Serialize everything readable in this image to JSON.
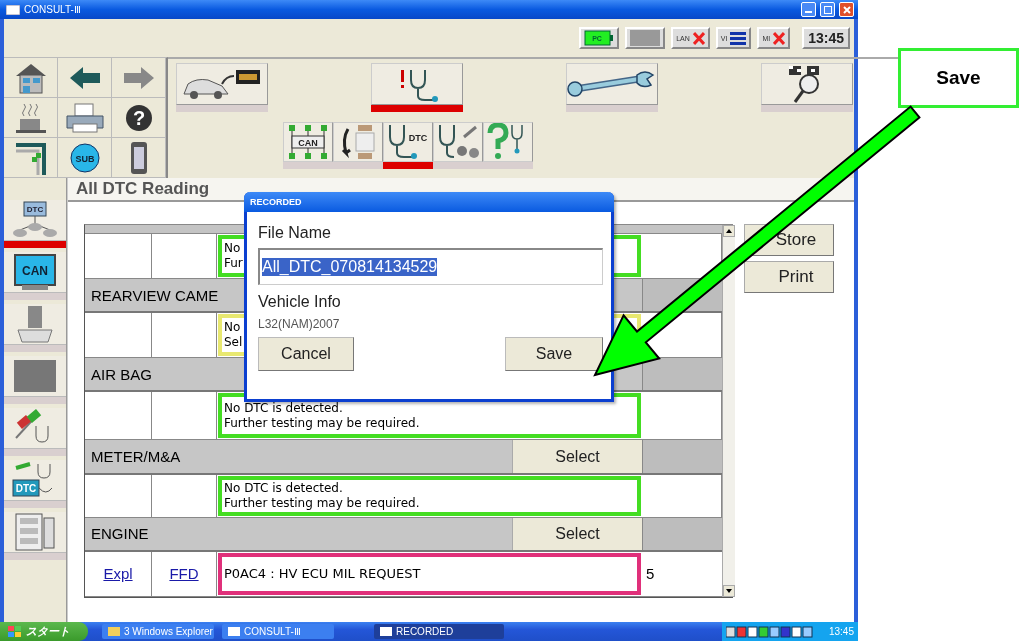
{
  "window": {
    "title": "CONSULT-Ⅲ"
  },
  "indicators": [
    {
      "kind": "battery",
      "label": "PC"
    },
    {
      "kind": "blank"
    },
    {
      "kind": "error",
      "label": "LAN"
    },
    {
      "kind": "bars",
      "label": "VI"
    },
    {
      "kind": "error",
      "label": "MI"
    }
  ],
  "clock": "13:45",
  "nav_labels": {
    "help": "?",
    "sub": "SUB"
  },
  "main_buttons": [
    {
      "selected": false
    },
    {
      "selected": true
    },
    {
      "selected": false
    },
    {
      "selected": false
    }
  ],
  "sub_buttons": [
    {
      "label": "CAN",
      "selected": false
    },
    {
      "selected": false
    },
    {
      "label": "DTC",
      "selected": true
    },
    {
      "selected": false
    },
    {
      "selected": false
    }
  ],
  "sidebar": [
    {
      "label": "DTC",
      "selected": true
    },
    {
      "label": "CAN",
      "selected": false
    },
    {
      "selected": false
    },
    {
      "selected": false
    },
    {
      "selected": false
    },
    {
      "label": "DTC",
      "selected": false
    },
    {
      "selected": false
    }
  ],
  "page": {
    "title": "All DTC Reading"
  },
  "results": [
    {
      "kind": "message",
      "color": "#44dd22",
      "lines": [
        "No",
        "Fur"
      ]
    },
    {
      "kind": "section",
      "name": "REARVIEW CAME"
    },
    {
      "kind": "message",
      "color": "#e8e870",
      "lines": [
        "No",
        "Sel"
      ]
    },
    {
      "kind": "section",
      "name": "AIR BAG"
    },
    {
      "kind": "message",
      "color": "#44dd22",
      "lines": [
        "No DTC is detected.",
        "Further testing may be required."
      ]
    },
    {
      "kind": "section",
      "name": "METER/M&A",
      "select": "Select"
    },
    {
      "kind": "message",
      "color": "#44dd22",
      "lines": [
        "No DTC is detected.",
        "Further testing may be required."
      ]
    },
    {
      "kind": "section",
      "name": "ENGINE",
      "select": "Select"
    },
    {
      "kind": "dtc",
      "color": "#e0307a",
      "links": [
        "Expl",
        "FFD"
      ],
      "lines": [
        "P0AC4 : HV ECU MIL REQUEST"
      ],
      "count": "5"
    }
  ],
  "side_buttons": [
    "Store",
    "Print"
  ],
  "dialog": {
    "title": "RECORDED",
    "file_label": "File Name",
    "file_name": "All_DTC_070814134529",
    "vehicle_label": "Vehicle Info",
    "vehicle": "L32(NAM)2007",
    "buttons": [
      "Cancel",
      "Save"
    ]
  },
  "taskbar": {
    "start": "スタート",
    "tasks": [
      {
        "label": "3 Windows Explorer",
        "selected": false
      },
      {
        "label": "CONSULT-Ⅲ",
        "selected": false
      },
      {
        "label": "RECORDED",
        "selected": true
      }
    ],
    "clock": "13:45"
  },
  "callout": {
    "label": "Save"
  }
}
